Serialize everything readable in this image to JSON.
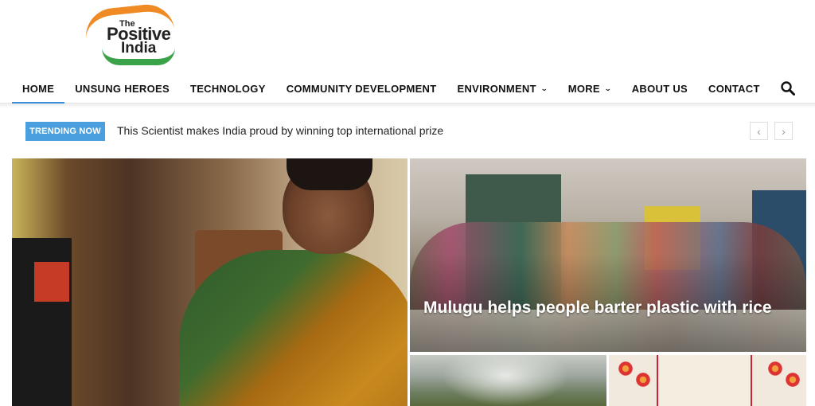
{
  "logo": {
    "line1": "The",
    "line2": "Positive",
    "line3": "India"
  },
  "nav": {
    "items": [
      {
        "label": "HOME",
        "active": true
      },
      {
        "label": "UNSUNG HEROES"
      },
      {
        "label": "TECHNOLOGY"
      },
      {
        "label": "COMMUNITY DEVELOPMENT"
      },
      {
        "label": "ENVIRONMENT",
        "dropdown": true
      },
      {
        "label": "MORE",
        "dropdown": true
      },
      {
        "label": "ABOUT US"
      },
      {
        "label": "CONTACT"
      }
    ],
    "search_icon": "search-icon"
  },
  "trending": {
    "badge": "TRENDING NOW",
    "headline": "This Scientist makes India proud by winning top international prize",
    "prev": "‹",
    "next": "›"
  },
  "featured": {
    "right_headline": "Mulugu helps people barter plastic with rice"
  },
  "colors": {
    "accent": "#4aa0de",
    "active_underline": "#3b8fd6",
    "logo_orange": "#f08a24",
    "logo_green": "#3aa34a"
  }
}
